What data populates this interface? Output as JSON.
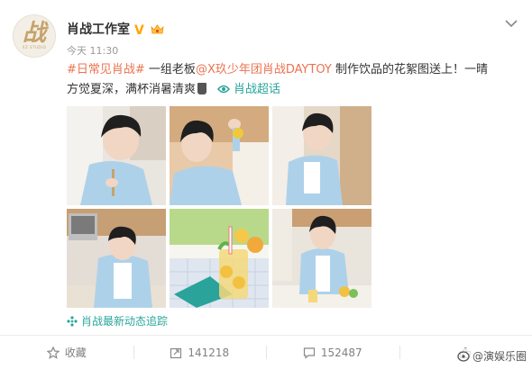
{
  "post": {
    "avatar_logo": "战",
    "avatar_subtext": "XZ STUDIO",
    "user_name": "肖战工作室",
    "time": "今天 11:30",
    "text": {
      "hashtag": "#日常见肖战#",
      "line1_after_tag": " 一组老板",
      "mention": "@X玖少年团肖战DAYTOY",
      "line1_rest": " 制作饮品的花絮图送上！一晴",
      "line2": "方觉夏深，满杯消暑清爽",
      "super_topic": "肖战超话"
    },
    "trend_link": "肖战最新动态追踪"
  },
  "actions": {
    "favorite_label": "收藏",
    "repost_count": "141218",
    "comment_count": "152487"
  },
  "watermark": "@演娱乐圈",
  "colors": {
    "link": "#eb7350",
    "topic": "#2aa59a",
    "verified": "#ffa500"
  },
  "photos": [
    "photo-1",
    "photo-2",
    "photo-3",
    "photo-4",
    "photo-5",
    "photo-6"
  ]
}
